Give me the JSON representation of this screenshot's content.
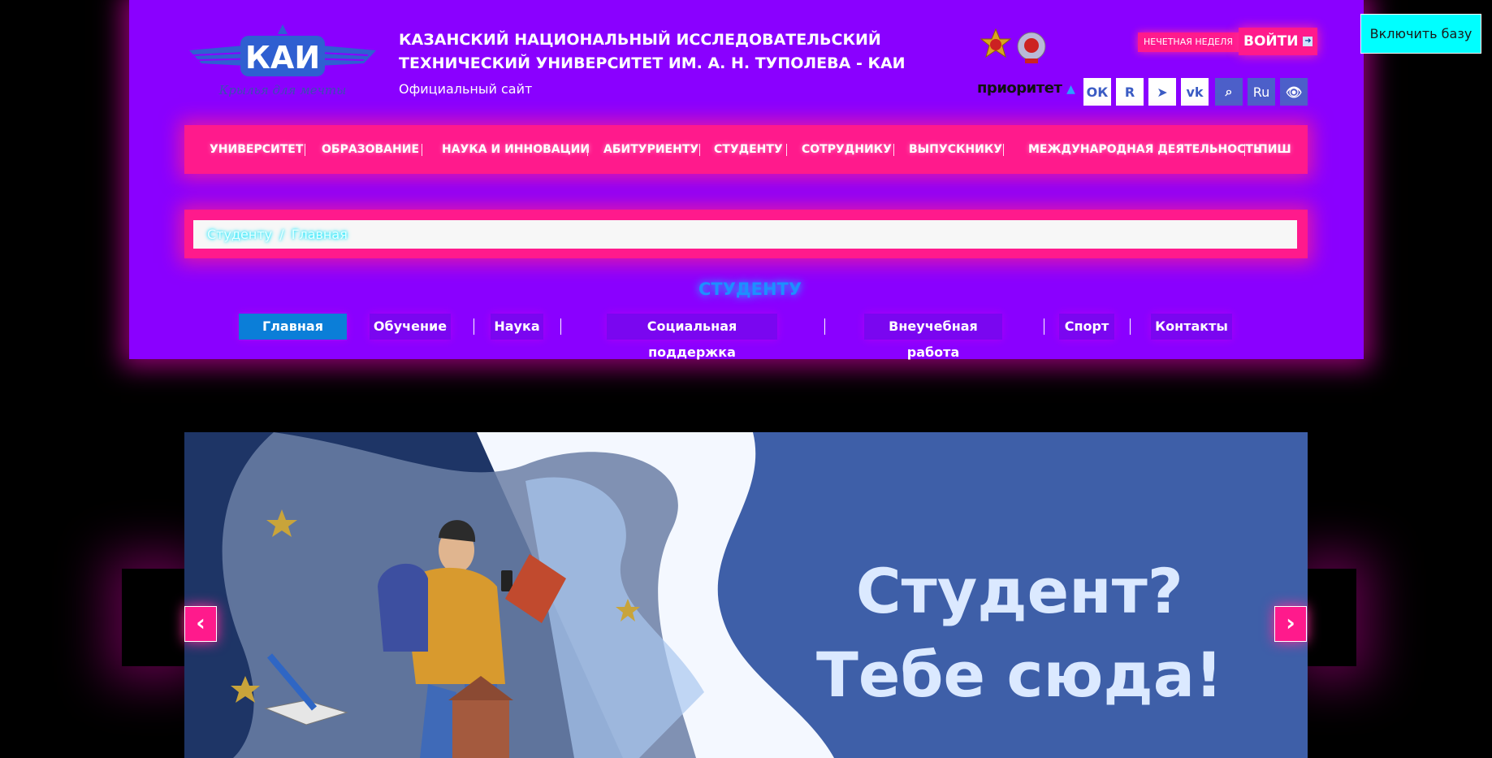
{
  "header": {
    "logo_text": "КАИ",
    "logo_motto": "Крылья для мечты",
    "title_line1": "КАЗАНСКИЙ НАЦИОНАЛЬНЫЙ ИССЛЕДОВАТЕЛЬСКИЙ",
    "title_line2": "ТЕХНИЧЕСКИЙ УНИВЕРСИТЕТ ИМ. А. Н. ТУПОЛЕВА - КАИ",
    "subtitle": "Официальный сайт",
    "week_label": "НЕЧЕТНАЯ НЕДЕЛЯ",
    "login_label": "ВОЙТИ",
    "enable_db_label": "Включить базу",
    "priority_label": "приоритет",
    "language": "Ru",
    "social_icons": [
      "odnoklassniki-icon",
      "rutube-icon",
      "telegram-icon",
      "vk-icon",
      "search-icon",
      "language-icon",
      "accessibility-icon"
    ],
    "accent_colors": {
      "panel": "#8a00ff",
      "pink": "#ff1a8c",
      "cyan": "#00ffff",
      "active_tab": "#0b7ed8"
    }
  },
  "main_nav": [
    "УНИВЕРСИТЕТ",
    "ОБРАЗОВАНИЕ",
    "НАУКА И ИННОВАЦИИ",
    "АБИТУРИЕНТУ",
    "СТУДЕНТУ",
    "СОТРУДНИКУ",
    "ВЫПУСКНИКУ",
    "МЕЖДУНАРОДНАЯ ДЕЯТЕЛЬНОСТЬ",
    "ПИШ"
  ],
  "breadcrumb": {
    "first": "Студенту",
    "separator": "/",
    "current": "Главная"
  },
  "section_title": "СТУДЕНТУ",
  "sub_nav": [
    "Главная",
    "Обучение",
    "Наука",
    "Социальная поддержка",
    "Внеучебная работа",
    "Спорт",
    "Контакты"
  ],
  "slider": {
    "headline_line1": "Студент?",
    "headline_line2": "Тебе сюда!",
    "prev_label": "‹",
    "next_label": "›"
  }
}
